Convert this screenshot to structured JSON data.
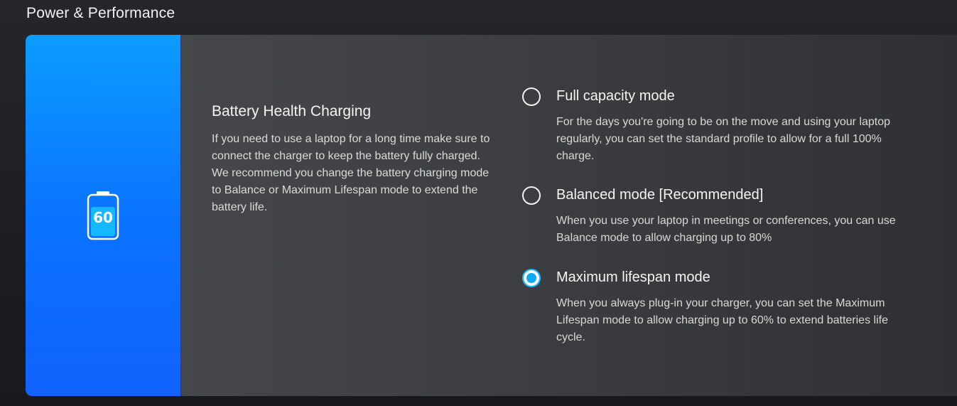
{
  "page": {
    "title": "Power & Performance"
  },
  "battery": {
    "level_label": "60",
    "icon": "battery-icon"
  },
  "section": {
    "title": "Battery Health Charging",
    "description": "If you need to use a laptop for a long time make sure to connect the charger to keep the battery fully charged. We recommend you change the battery charging mode to Balance or Maximum Lifespan mode to extend the battery life."
  },
  "options": [
    {
      "label": "Full capacity mode",
      "description": "For the days you're going to be on the move and using your laptop regularly, you can set the standard profile to allow for a full 100% charge.",
      "selected": false
    },
    {
      "label": "Balanced mode [Recommended]",
      "description": "When you use your laptop in meetings or conferences, you can use Balance mode to allow charging up to 80%",
      "selected": false
    },
    {
      "label": "Maximum lifespan mode",
      "description": "When you always plug-in your charger, you can set the Maximum Lifespan mode to allow charging up to 60% to extend batteries life cycle.",
      "selected": true
    }
  ],
  "colors": {
    "accent": "#0fa8f5",
    "panel_top": "#0c9cff",
    "panel_bottom": "#1162ff"
  }
}
